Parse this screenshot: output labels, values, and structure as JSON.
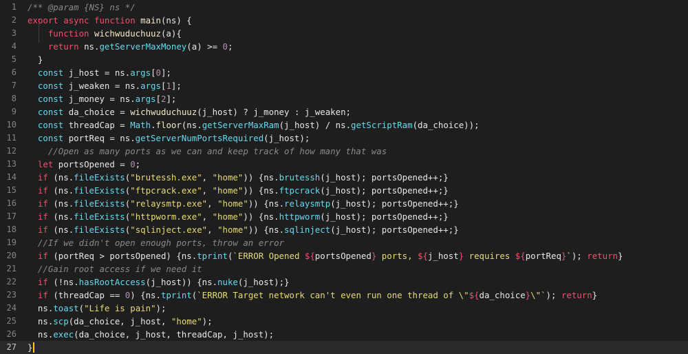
{
  "theme": {
    "background": "#1e1e1e",
    "line_number": "#858585",
    "current_line": "#2a2a2a",
    "colors": {
      "p": "#e8e8e8",
      "k": "#f0506e",
      "f": "#66d9ef",
      "fn": "#f5e9c8",
      "s": "#e6db74",
      "n": "#b48ead",
      "c": "#8a8a8a",
      "t": "#f0506e"
    }
  },
  "editor": {
    "lines": [
      {
        "num": "1",
        "tokens": [
          {
            "t": "/** @param {NS} ns */",
            "c": "c"
          }
        ]
      },
      {
        "num": "2",
        "tokens": [
          {
            "t": "export ",
            "c": "k"
          },
          {
            "t": "async ",
            "c": "k"
          },
          {
            "t": "function ",
            "c": "k"
          },
          {
            "t": "main",
            "c": "fn"
          },
          {
            "t": "(ns) {",
            "c": "p"
          }
        ]
      },
      {
        "num": "3",
        "tokens": [
          {
            "t": "    ",
            "c": "p"
          },
          {
            "t": "function ",
            "c": "k"
          },
          {
            "t": "wichwuduchuuz",
            "c": "fn"
          },
          {
            "t": "(a){",
            "c": "p"
          }
        ]
      },
      {
        "num": "4",
        "tokens": [
          {
            "t": "    ",
            "c": "p"
          },
          {
            "t": "return ",
            "c": "k"
          },
          {
            "t": "ns.",
            "c": "p"
          },
          {
            "t": "getServerMaxMoney",
            "c": "f"
          },
          {
            "t": "(a) >= ",
            "c": "p"
          },
          {
            "t": "0",
            "c": "n"
          },
          {
            "t": ";",
            "c": "p"
          }
        ]
      },
      {
        "num": "5",
        "tokens": [
          {
            "t": "  }",
            "c": "p"
          }
        ]
      },
      {
        "num": "6",
        "tokens": [
          {
            "t": "  ",
            "c": "p"
          },
          {
            "t": "const ",
            "c": "f"
          },
          {
            "t": "j_host = ns.",
            "c": "p"
          },
          {
            "t": "args",
            "c": "f"
          },
          {
            "t": "[",
            "c": "p"
          },
          {
            "t": "0",
            "c": "n"
          },
          {
            "t": "];",
            "c": "p"
          }
        ]
      },
      {
        "num": "7",
        "tokens": [
          {
            "t": "  ",
            "c": "p"
          },
          {
            "t": "const ",
            "c": "f"
          },
          {
            "t": "j_weaken = ns.",
            "c": "p"
          },
          {
            "t": "args",
            "c": "f"
          },
          {
            "t": "[",
            "c": "p"
          },
          {
            "t": "1",
            "c": "n"
          },
          {
            "t": "];",
            "c": "p"
          }
        ]
      },
      {
        "num": "8",
        "tokens": [
          {
            "t": "  ",
            "c": "p"
          },
          {
            "t": "const ",
            "c": "f"
          },
          {
            "t": "j_money = ns.",
            "c": "p"
          },
          {
            "t": "args",
            "c": "f"
          },
          {
            "t": "[",
            "c": "p"
          },
          {
            "t": "2",
            "c": "n"
          },
          {
            "t": "];",
            "c": "p"
          }
        ]
      },
      {
        "num": "9",
        "tokens": [
          {
            "t": "  ",
            "c": "p"
          },
          {
            "t": "const ",
            "c": "f"
          },
          {
            "t": "da_choice = ",
            "c": "p"
          },
          {
            "t": "wichwuduchuuz",
            "c": "fn"
          },
          {
            "t": "(j_host) ? j_money : j_weaken;",
            "c": "p"
          }
        ]
      },
      {
        "num": "10",
        "tokens": [
          {
            "t": "  ",
            "c": "p"
          },
          {
            "t": "const ",
            "c": "f"
          },
          {
            "t": "threadCap = ",
            "c": "p"
          },
          {
            "t": "Math",
            "c": "f"
          },
          {
            "t": ".",
            "c": "p"
          },
          {
            "t": "floor",
            "c": "fn"
          },
          {
            "t": "(ns.",
            "c": "p"
          },
          {
            "t": "getServerMaxRam",
            "c": "f"
          },
          {
            "t": "(j_host) / ns.",
            "c": "p"
          },
          {
            "t": "getScriptRam",
            "c": "f"
          },
          {
            "t": "(da_choice));",
            "c": "p"
          }
        ]
      },
      {
        "num": "11",
        "tokens": [
          {
            "t": "  ",
            "c": "p"
          },
          {
            "t": "const ",
            "c": "f"
          },
          {
            "t": "portReq = ns.",
            "c": "p"
          },
          {
            "t": "getServerNumPortsRequired",
            "c": "f"
          },
          {
            "t": "(j_host);",
            "c": "p"
          }
        ]
      },
      {
        "num": "12",
        "tokens": [
          {
            "t": "    ",
            "c": "p"
          },
          {
            "t": "//Open as many ports as we can and keep track of how many that was",
            "c": "c"
          }
        ]
      },
      {
        "num": "13",
        "tokens": [
          {
            "t": "  ",
            "c": "p"
          },
          {
            "t": "let ",
            "c": "k"
          },
          {
            "t": "portsOpened = ",
            "c": "p"
          },
          {
            "t": "0",
            "c": "n"
          },
          {
            "t": ";",
            "c": "p"
          }
        ]
      },
      {
        "num": "14",
        "tokens": [
          {
            "t": "  ",
            "c": "p"
          },
          {
            "t": "if ",
            "c": "k"
          },
          {
            "t": "(ns.",
            "c": "p"
          },
          {
            "t": "fileExists",
            "c": "f"
          },
          {
            "t": "(",
            "c": "p"
          },
          {
            "t": "\"brutessh.exe\"",
            "c": "s"
          },
          {
            "t": ", ",
            "c": "p"
          },
          {
            "t": "\"home\"",
            "c": "s"
          },
          {
            "t": ")) {ns.",
            "c": "p"
          },
          {
            "t": "brutessh",
            "c": "f"
          },
          {
            "t": "(j_host); portsOpened++;}",
            "c": "p"
          }
        ]
      },
      {
        "num": "15",
        "tokens": [
          {
            "t": "  ",
            "c": "p"
          },
          {
            "t": "if ",
            "c": "k"
          },
          {
            "t": "(ns.",
            "c": "p"
          },
          {
            "t": "fileExists",
            "c": "f"
          },
          {
            "t": "(",
            "c": "p"
          },
          {
            "t": "\"ftpcrack.exe\"",
            "c": "s"
          },
          {
            "t": ", ",
            "c": "p"
          },
          {
            "t": "\"home\"",
            "c": "s"
          },
          {
            "t": ")) {ns.",
            "c": "p"
          },
          {
            "t": "ftpcrack",
            "c": "f"
          },
          {
            "t": "(j_host); portsOpened++;}",
            "c": "p"
          }
        ]
      },
      {
        "num": "16",
        "tokens": [
          {
            "t": "  ",
            "c": "p"
          },
          {
            "t": "if ",
            "c": "k"
          },
          {
            "t": "(ns.",
            "c": "p"
          },
          {
            "t": "fileExists",
            "c": "f"
          },
          {
            "t": "(",
            "c": "p"
          },
          {
            "t": "\"relaysmtp.exe\"",
            "c": "s"
          },
          {
            "t": ", ",
            "c": "p"
          },
          {
            "t": "\"home\"",
            "c": "s"
          },
          {
            "t": ")) {ns.",
            "c": "p"
          },
          {
            "t": "relaysmtp",
            "c": "f"
          },
          {
            "t": "(j_host); portsOpened++;}",
            "c": "p"
          }
        ]
      },
      {
        "num": "17",
        "tokens": [
          {
            "t": "  ",
            "c": "p"
          },
          {
            "t": "if ",
            "c": "k"
          },
          {
            "t": "(ns.",
            "c": "p"
          },
          {
            "t": "fileExists",
            "c": "f"
          },
          {
            "t": "(",
            "c": "p"
          },
          {
            "t": "\"httpworm.exe\"",
            "c": "s"
          },
          {
            "t": ", ",
            "c": "p"
          },
          {
            "t": "\"home\"",
            "c": "s"
          },
          {
            "t": ")) {ns.",
            "c": "p"
          },
          {
            "t": "httpworm",
            "c": "f"
          },
          {
            "t": "(j_host); portsOpened++;}",
            "c": "p"
          }
        ]
      },
      {
        "num": "18",
        "tokens": [
          {
            "t": "  ",
            "c": "p"
          },
          {
            "t": "if ",
            "c": "k"
          },
          {
            "t": "(ns.",
            "c": "p"
          },
          {
            "t": "fileExists",
            "c": "f"
          },
          {
            "t": "(",
            "c": "p"
          },
          {
            "t": "\"sqlinject.exe\"",
            "c": "s"
          },
          {
            "t": ", ",
            "c": "p"
          },
          {
            "t": "\"home\"",
            "c": "s"
          },
          {
            "t": ")) {ns.",
            "c": "p"
          },
          {
            "t": "sqlinject",
            "c": "f"
          },
          {
            "t": "(j_host); portsOpened++;}",
            "c": "p"
          }
        ]
      },
      {
        "num": "19",
        "tokens": [
          {
            "t": "  ",
            "c": "p"
          },
          {
            "t": "//If we didn't open enough ports, throw an error",
            "c": "c"
          }
        ]
      },
      {
        "num": "20",
        "tokens": [
          {
            "t": "  ",
            "c": "p"
          },
          {
            "t": "if ",
            "c": "k"
          },
          {
            "t": "(portReq > portsOpened) {ns.",
            "c": "p"
          },
          {
            "t": "tprint",
            "c": "f"
          },
          {
            "t": "(",
            "c": "p"
          },
          {
            "t": "`ERROR Opened ",
            "c": "s"
          },
          {
            "t": "${",
            "c": "k"
          },
          {
            "t": "portsOpened",
            "c": "p"
          },
          {
            "t": "}",
            "c": "k"
          },
          {
            "t": " ports, ",
            "c": "s"
          },
          {
            "t": "${",
            "c": "k"
          },
          {
            "t": "j_host",
            "c": "p"
          },
          {
            "t": "}",
            "c": "k"
          },
          {
            "t": " requires ",
            "c": "s"
          },
          {
            "t": "${",
            "c": "k"
          },
          {
            "t": "portReq",
            "c": "p"
          },
          {
            "t": "}",
            "c": "k"
          },
          {
            "t": "`",
            "c": "s"
          },
          {
            "t": "); ",
            "c": "p"
          },
          {
            "t": "return",
            "c": "k"
          },
          {
            "t": "}",
            "c": "p"
          }
        ]
      },
      {
        "num": "21",
        "tokens": [
          {
            "t": "  ",
            "c": "p"
          },
          {
            "t": "//Gain root access if we need it",
            "c": "c"
          }
        ]
      },
      {
        "num": "22",
        "tokens": [
          {
            "t": "  ",
            "c": "p"
          },
          {
            "t": "if ",
            "c": "k"
          },
          {
            "t": "(!ns.",
            "c": "p"
          },
          {
            "t": "hasRootAccess",
            "c": "f"
          },
          {
            "t": "(j_host)) {ns.",
            "c": "p"
          },
          {
            "t": "nuke",
            "c": "f"
          },
          {
            "t": "(j_host);}",
            "c": "p"
          }
        ]
      },
      {
        "num": "23",
        "tokens": [
          {
            "t": "  ",
            "c": "p"
          },
          {
            "t": "if ",
            "c": "k"
          },
          {
            "t": "(threadCap == ",
            "c": "p"
          },
          {
            "t": "0",
            "c": "n"
          },
          {
            "t": ") {ns.",
            "c": "p"
          },
          {
            "t": "tprint",
            "c": "f"
          },
          {
            "t": "(",
            "c": "p"
          },
          {
            "t": "`ERROR Target network can't even run one thread of \\\"",
            "c": "s"
          },
          {
            "t": "${",
            "c": "k"
          },
          {
            "t": "da_choice",
            "c": "p"
          },
          {
            "t": "}",
            "c": "k"
          },
          {
            "t": "\\\"`",
            "c": "s"
          },
          {
            "t": "); ",
            "c": "p"
          },
          {
            "t": "return",
            "c": "k"
          },
          {
            "t": "}",
            "c": "p"
          }
        ]
      },
      {
        "num": "24",
        "tokens": [
          {
            "t": "  ",
            "c": "p"
          },
          {
            "t": "ns.",
            "c": "p"
          },
          {
            "t": "toast",
            "c": "f"
          },
          {
            "t": "(",
            "c": "p"
          },
          {
            "t": "\"Life is pain\"",
            "c": "s"
          },
          {
            "t": ");",
            "c": "p"
          }
        ]
      },
      {
        "num": "25",
        "tokens": [
          {
            "t": "  ",
            "c": "p"
          },
          {
            "t": "ns.",
            "c": "p"
          },
          {
            "t": "scp",
            "c": "f"
          },
          {
            "t": "(da_choice, j_host, ",
            "c": "p"
          },
          {
            "t": "\"home\"",
            "c": "s"
          },
          {
            "t": ");",
            "c": "p"
          }
        ]
      },
      {
        "num": "26",
        "tokens": [
          {
            "t": "  ",
            "c": "p"
          },
          {
            "t": "ns.",
            "c": "p"
          },
          {
            "t": "exec",
            "c": "f"
          },
          {
            "t": "(da_choice, j_host, threadCap, j_host);",
            "c": "p"
          }
        ]
      },
      {
        "num": "27",
        "tokens": [
          {
            "t": "}",
            "c": "p"
          }
        ],
        "current": true
      }
    ]
  }
}
